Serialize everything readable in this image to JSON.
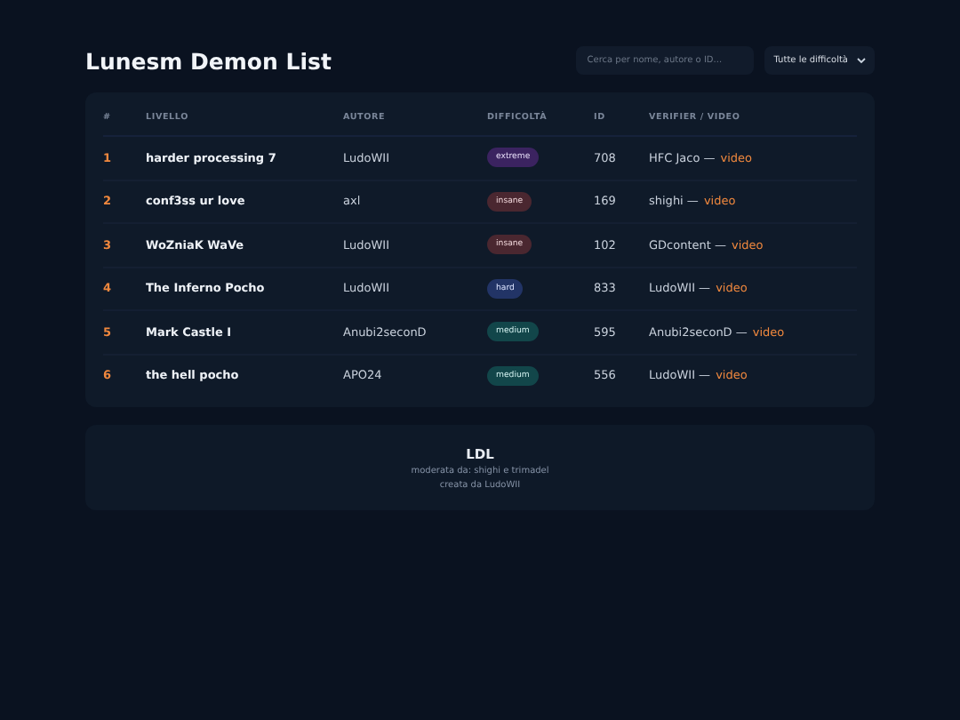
{
  "header": {
    "title": "Lunesm Demon List",
    "search": {
      "placeholder": "Cerca per nome, autore o ID..."
    },
    "filter": {
      "value": "Tutte le difficoltà"
    }
  },
  "table": {
    "columns": [
      "#",
      "LIVELLO",
      "AUTORE",
      "DIFFICOLTÀ",
      "ID",
      "VERIFIER / VIDEO"
    ],
    "rows": [
      {
        "rank": "1",
        "level": "harder processing 7",
        "author": "LudoWII",
        "difficulty": {
          "kind": "extreme",
          "label": "extreme"
        },
        "id": "708",
        "verifier": "HFC Jaco —",
        "link": "video"
      },
      {
        "rank": "2",
        "level": "conf3ss ur love",
        "author": "axl",
        "difficulty": {
          "kind": "insane",
          "label": "insane"
        },
        "id": "169",
        "verifier": "shighi —",
        "link": "video"
      },
      {
        "rank": "3",
        "level": "WoZniaK WaVe",
        "author": "LudoWII",
        "difficulty": {
          "kind": "insane",
          "label": "insane"
        },
        "id": "102",
        "verifier": "GDcontent —",
        "link": "video"
      },
      {
        "rank": "4",
        "level": "The Inferno Pocho",
        "author": "LudoWII",
        "difficulty": {
          "kind": "hard",
          "label": "hard"
        },
        "id": "833",
        "verifier": "LudoWII —",
        "link": "video"
      },
      {
        "rank": "5",
        "level": "Mark Castle I",
        "author": "Anubi2seconD",
        "difficulty": {
          "kind": "medium",
          "label": "medium"
        },
        "id": "595",
        "verifier": "Anubi2seconD —",
        "link": "video"
      },
      {
        "rank": "6",
        "level": "the hell pocho",
        "author": "APO24",
        "difficulty": {
          "kind": "medium",
          "label": "medium"
        },
        "id": "556",
        "verifier": "LudoWII —",
        "link": "video"
      }
    ]
  },
  "footer": {
    "title": "LDL",
    "lines": [
      "moderata da: shighi e trimadel",
      "creata da LudoWII"
    ]
  }
}
